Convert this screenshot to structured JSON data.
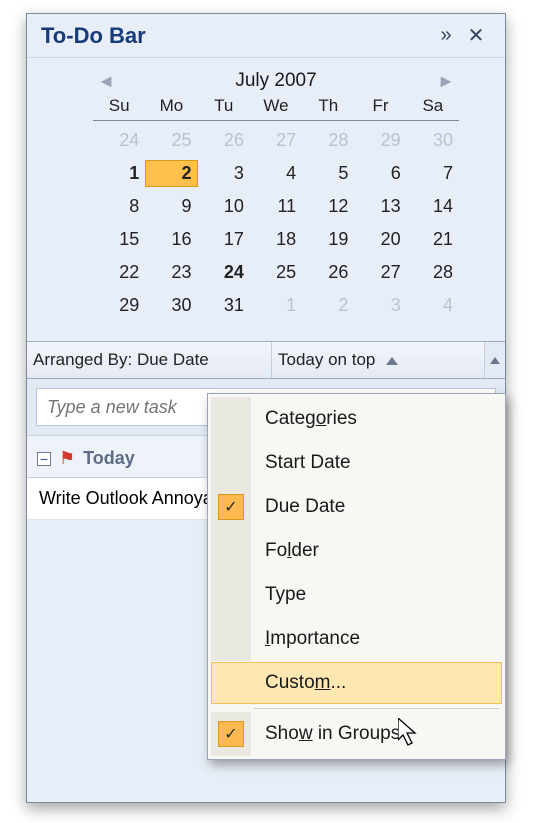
{
  "title": "To-Do Bar",
  "calendar": {
    "month_label": "July 2007",
    "day_headers": [
      "Su",
      "Mo",
      "Tu",
      "We",
      "Th",
      "Fr",
      "Sa"
    ],
    "cells": [
      {
        "n": "24",
        "dim": true
      },
      {
        "n": "25",
        "dim": true
      },
      {
        "n": "26",
        "dim": true
      },
      {
        "n": "27",
        "dim": true
      },
      {
        "n": "28",
        "dim": true
      },
      {
        "n": "29",
        "dim": true
      },
      {
        "n": "30",
        "dim": true
      },
      {
        "n": "1",
        "bold": true
      },
      {
        "n": "2",
        "bold": true,
        "selected": true
      },
      {
        "n": "3"
      },
      {
        "n": "4"
      },
      {
        "n": "5"
      },
      {
        "n": "6"
      },
      {
        "n": "7"
      },
      {
        "n": "8"
      },
      {
        "n": "9"
      },
      {
        "n": "10"
      },
      {
        "n": "11"
      },
      {
        "n": "12"
      },
      {
        "n": "13"
      },
      {
        "n": "14"
      },
      {
        "n": "15"
      },
      {
        "n": "16"
      },
      {
        "n": "17"
      },
      {
        "n": "18"
      },
      {
        "n": "19"
      },
      {
        "n": "20"
      },
      {
        "n": "21"
      },
      {
        "n": "22"
      },
      {
        "n": "23"
      },
      {
        "n": "24",
        "bold": true
      },
      {
        "n": "25"
      },
      {
        "n": "26"
      },
      {
        "n": "27"
      },
      {
        "n": "28"
      },
      {
        "n": "29"
      },
      {
        "n": "30"
      },
      {
        "n": "31"
      },
      {
        "n": "1",
        "dim": true
      },
      {
        "n": "2",
        "dim": true
      },
      {
        "n": "3",
        "dim": true
      },
      {
        "n": "4",
        "dim": true
      }
    ]
  },
  "task_header": {
    "arranged_by": "Arranged By: Due Date",
    "sort": "Today on top"
  },
  "new_task_placeholder": "Type a new task",
  "group": {
    "label": "Today",
    "collapse_glyph": "−"
  },
  "task_item_text": "Write Outlook Annoyances",
  "menu": {
    "items": [
      {
        "label": "Categories",
        "ul": "o",
        "checked": false
      },
      {
        "label": "Start Date",
        "ul": "",
        "checked": false
      },
      {
        "label": "Due Date",
        "ul": "",
        "checked": true
      },
      {
        "label": "Folder",
        "ul": "l",
        "checked": false
      },
      {
        "label": "Type",
        "ul": "",
        "checked": false
      },
      {
        "label": "Importance",
        "ul": "I",
        "checked": false
      },
      {
        "label": "Custom...",
        "ul": "m",
        "checked": false,
        "hover": true
      }
    ],
    "sep_after": 6,
    "footer": {
      "label": "Show in Groups",
      "ul": "w",
      "checked": true
    }
  }
}
